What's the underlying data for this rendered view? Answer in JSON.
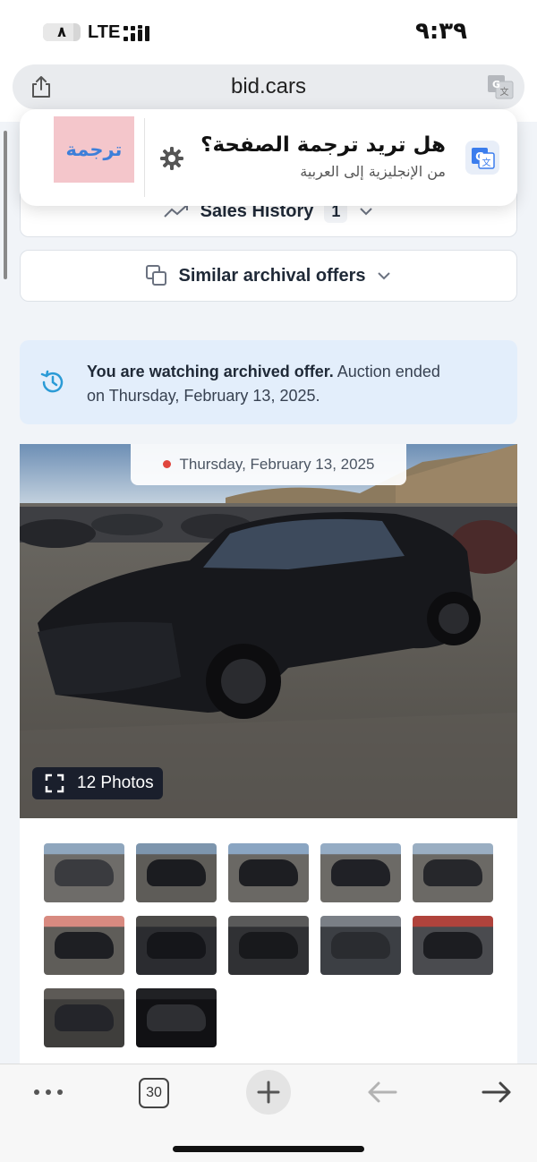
{
  "status_bar": {
    "battery_level_text": "٨",
    "battery_level_fraction": 0.8,
    "network": "LTE",
    "signal_icon": "signal-bars-icon",
    "time": "٩:٣٩"
  },
  "url_bar": {
    "url": "bid.cars",
    "left_icon": "share-icon",
    "right_icon": "translate-icon"
  },
  "translate_popup": {
    "title": "هل تريد ترجمة الصفحة؟",
    "subtitle": "من الإنجليزية إلى العربية",
    "button_label": "ترجمة",
    "settings_icon": "gear-icon",
    "logo_icon": "google-translate-icon",
    "button_color": "#f4c6cb"
  },
  "sales_history": {
    "label": "Sales History",
    "count": "1",
    "icon": "trend-chart-icon"
  },
  "similar_offers": {
    "label": "Similar archival offers",
    "icon": "copy-squares-icon"
  },
  "archive_notice": {
    "strong_text": "You are watching archived offer.",
    "text": " Auction ended on Thursday, February 13, 2025.",
    "icon": "history-clock-icon",
    "accent_color": "#2b9bd6",
    "background": "#e3eefb"
  },
  "gallery": {
    "date_label": "Thursday, February 13, 2025",
    "photos_badge": "12 Photos",
    "expand_icon": "expand-corners-icon",
    "thumbnail_count": 12
  },
  "toolbar": {
    "tabs_count": "30",
    "more_icon": "more-dots-icon",
    "new_tab_icon": "plus-icon",
    "back_icon": "arrow-left-icon",
    "forward_icon": "arrow-right-icon"
  },
  "colors": {
    "page_background": "#f1f4f8",
    "card_border": "#dde2e8",
    "text_dark": "#1f2937"
  }
}
